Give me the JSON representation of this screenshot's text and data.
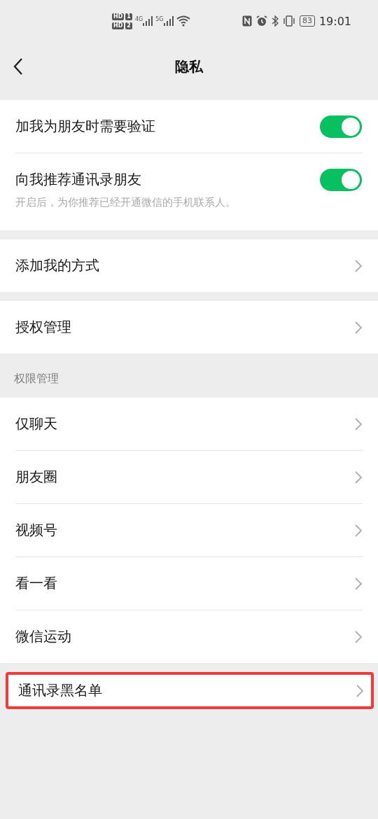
{
  "status_bar": {
    "sims": [
      {
        "badge": "HD",
        "slot": "1",
        "network": "4G"
      },
      {
        "badge": "HD",
        "slot": "2",
        "network": "5G"
      }
    ],
    "battery": "83",
    "time": "19:01"
  },
  "header": {
    "title": "隐私"
  },
  "sections": [
    {
      "highlighted": false,
      "rows": [
        {
          "kind": "toggle",
          "label": "加我为朋友时需要验证",
          "on": true
        },
        {
          "kind": "toggle",
          "label": "向我推荐通讯录朋友",
          "on": true,
          "hint": "开启后，为你推荐已经开通微信的手机联系人。"
        }
      ]
    },
    {
      "highlighted": false,
      "rows": [
        {
          "kind": "link",
          "label": "添加我的方式"
        }
      ]
    },
    {
      "highlighted": false,
      "rows": [
        {
          "kind": "link",
          "label": "授权管理"
        }
      ]
    },
    {
      "title": "权限管理",
      "highlighted": false,
      "rows": [
        {
          "kind": "link",
          "label": "仅聊天"
        },
        {
          "kind": "link",
          "label": "朋友圈"
        },
        {
          "kind": "link",
          "label": "视频号"
        },
        {
          "kind": "link",
          "label": "看一看"
        },
        {
          "kind": "link",
          "label": "微信运动"
        }
      ]
    },
    {
      "highlighted": true,
      "rows": [
        {
          "kind": "link",
          "label": "通讯录黑名单"
        }
      ]
    }
  ]
}
